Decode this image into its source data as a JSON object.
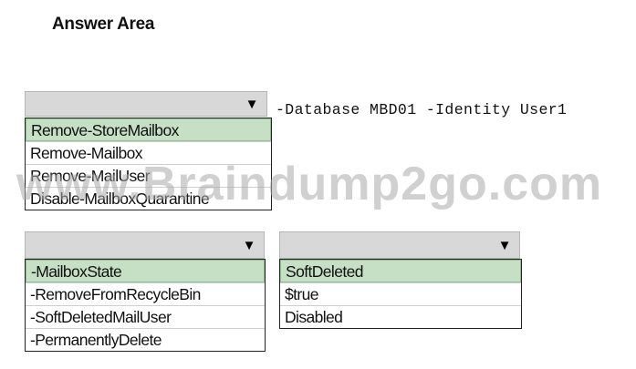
{
  "heading": "Answer Area",
  "command_suffix": "-Database MBD01 -Identity User1",
  "dropdown1": {
    "arrow_icon": "triangle-down-icon",
    "options": [
      "Remove-StoreMailbox",
      "Remove-Mailbox",
      "Remove-MailUser",
      "Disable-MailboxQuarantine"
    ],
    "selected_index": 0
  },
  "dropdown2": {
    "arrow_icon": "triangle-down-icon",
    "options": [
      "-MailboxState",
      "-RemoveFromRecycleBin",
      "-SoftDeletedMailUser",
      "-PermanentlyDelete"
    ],
    "selected_index": 0
  },
  "dropdown3": {
    "arrow_icon": "triangle-down-icon",
    "options": [
      "SoftDeleted",
      "$true",
      "Disabled"
    ],
    "selected_index": 0
  },
  "watermark": "www.Braindump2go.com",
  "colors": {
    "selected_bg": "#c6e0c6",
    "header_bg": "#d8d8d8"
  }
}
